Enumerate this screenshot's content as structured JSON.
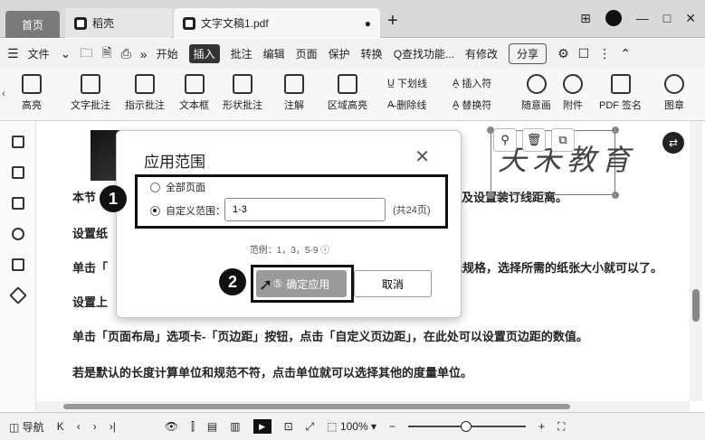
{
  "titlebar": {
    "tabs": [
      {
        "label": "首页"
      },
      {
        "label": "稻壳"
      },
      {
        "label": "文字文稿1.pdf"
      }
    ],
    "new_tab": "+",
    "controls": [
      "⊞",
      "—",
      "□",
      "✕"
    ]
  },
  "menubar": {
    "file": "文件",
    "items": [
      "开始",
      "插入",
      "批注",
      "编辑",
      "页面",
      "保护",
      "转换"
    ],
    "active_item": "插入",
    "search": "Q查找功能...",
    "unsaved": "有修改",
    "share": "分享"
  },
  "ribbon": {
    "buttons": [
      "高亮",
      "文字批注",
      "指示批注",
      "文本框",
      "形状批注",
      "注解",
      "区域高亮",
      "随意画",
      "附件",
      "PDF 签名",
      "图章"
    ],
    "inline_top": [
      "下划线",
      "插入符"
    ],
    "inline_bottom": [
      "删除线",
      "替换符"
    ]
  },
  "document": {
    "lines": [
      "本节",
      "及设置装订线距离。",
      "设置纸",
      "单击「",
      "纸规格，选择所需的纸张大小就可以了。",
      "设置上",
      "单击「页面布局」选项卡-「页边距」按钮，点击「自定义页边距」，在此处可以设置页边距的数值。",
      "若是默认的长度计算单位和规范不符，点击单位就可以选择其他的度量单位。"
    ],
    "signature": "天禾教育"
  },
  "dialog": {
    "title": "应用范围",
    "option_all": "全部页面",
    "option_custom": "自定义范围：",
    "range_value": "1-3",
    "total_pages": "(共24页)",
    "example": "范例：1，3，5-9",
    "confirm": "确定应用",
    "cancel": "取消"
  },
  "markers": [
    "1",
    "2"
  ],
  "statusbar": {
    "nav": "导航",
    "zoom": "100%"
  }
}
